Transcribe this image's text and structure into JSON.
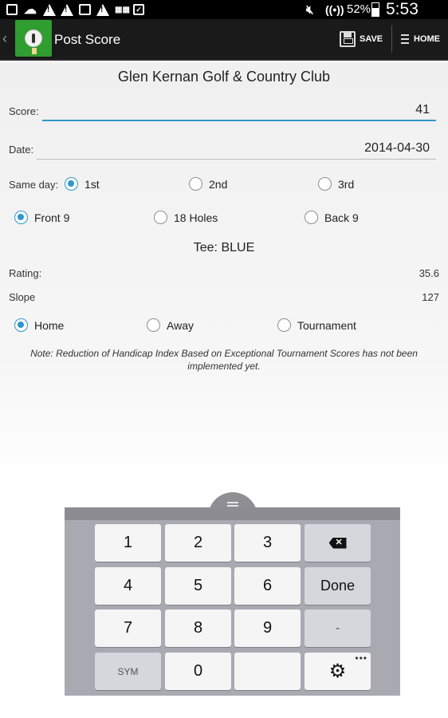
{
  "status_bar": {
    "battery": "52%",
    "time": "5:53 PM",
    "left_icons": [
      "image-icon",
      "upload-icon",
      "warning-icon",
      "warning-icon",
      "play-store-icon",
      "warning-icon",
      "keyboard-icon",
      "clipboard-check-icon"
    ],
    "right_icons": [
      "mute-icon",
      "wifi-icon",
      "battery-icon"
    ]
  },
  "action_bar": {
    "title": "Post Score",
    "save_label": "SAVE",
    "home_label": "HOME"
  },
  "form": {
    "club_name": "Glen Kernan Golf & Country Club",
    "score_label": "Score:",
    "score_value": "41",
    "date_label": "Date:",
    "date_value": "2014-04-30",
    "same_day_label": "Same day:",
    "same_day_options": [
      "1st",
      "2nd",
      "3rd"
    ],
    "same_day_selected": "1st",
    "holes_options": [
      "Front 9",
      "18 Holes",
      "Back 9"
    ],
    "holes_selected": "Front 9",
    "tee": "Tee: BLUE",
    "rating_label": "Rating:",
    "rating_value": "35.6",
    "slope_label": "Slope",
    "slope_value": "127",
    "location_options": [
      "Home",
      "Away",
      "Tournament"
    ],
    "location_selected": "Home",
    "note": "Note: Reduction of Handicap Index Based on Exceptional Tournament Scores has not been implemented yet."
  },
  "keyboard": {
    "keys": [
      "1",
      "2",
      "3",
      "4",
      "5",
      "6",
      "Done",
      "7",
      "8",
      "9",
      "-",
      "SYM",
      "0"
    ]
  },
  "colors": {
    "accent": "#2e97c9",
    "action_bar": "#1a1a1a",
    "logo_green": "#2f9d2f"
  }
}
